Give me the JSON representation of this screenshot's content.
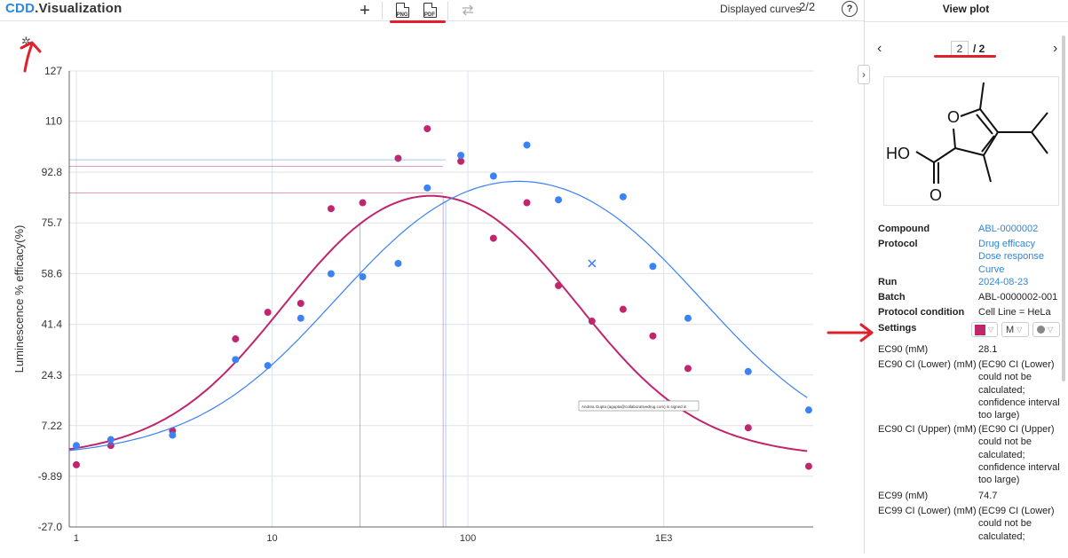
{
  "app": {
    "brand": "CDD",
    "product": "Visualization"
  },
  "toolbar": {
    "add_icon": "plus-icon",
    "png_label": "PNG",
    "pdf_label": "PDF",
    "swap_icon": "swap-icon",
    "displayed_curves_label": "Displayed curves",
    "displayed_curves_value": "2/2",
    "help_label": "?"
  },
  "panel": {
    "title": "View plot",
    "page_current": "2",
    "page_total": "/ 2",
    "properties": [
      {
        "label": "Compound",
        "value": "ABL-0000002",
        "link": true
      },
      {
        "label": "Protocol",
        "value": "Drug efficacy Dose response Curve",
        "link": true
      },
      {
        "label": "Run",
        "value": "2024-08-23",
        "link": true
      },
      {
        "label": "Batch",
        "value": "ABL-0000002-001",
        "link": false
      },
      {
        "label": "Protocol condition",
        "value": "Cell Line = HeLa",
        "link": false
      }
    ],
    "settings_label": "Settings",
    "settings": {
      "color": "#c0256e",
      "method": "M",
      "marker": "circle"
    },
    "results": [
      {
        "label": "EC90 (mM)",
        "value": "28.1"
      },
      {
        "label": "EC90 CI (Lower) (mM)",
        "value": "(EC90 CI (Lower) could not be calculated; confidence interval too large)"
      },
      {
        "label": "EC90 CI (Upper) (mM)",
        "value": "(EC90 CI (Upper) could not be calculated; confidence interval too large)"
      },
      {
        "label": "EC99 (mM)",
        "value": "74.7"
      },
      {
        "label": "EC99 CI (Lower) (mM)",
        "value": "(EC99 CI (Lower) could not be calculated;"
      }
    ]
  },
  "structure": {
    "atom_o_ring": "O",
    "atom_oh": "HO",
    "atom_o_carbonyl": "O"
  },
  "tooltip_text": "Andrea Gupta (agupta@collaborativedrug.com) is signed in",
  "chart_data": {
    "type": "scatter",
    "xscale": "log",
    "xlim": [
      0.92,
      5800
    ],
    "ylim": [
      -27.0,
      127
    ],
    "ylabel": "Luminescence % efficacy(%)",
    "xticks": [
      1,
      10,
      100,
      1000
    ],
    "xtick_labels": [
      "1",
      "10",
      "100",
      "1E3"
    ],
    "yticks": [
      -27.0,
      -9.89,
      7.22,
      24.3,
      41.4,
      58.6,
      75.7,
      92.8,
      110,
      127
    ],
    "ytick_labels": [
      "-27.0",
      "-9.89",
      "7.22",
      "24.3",
      "41.4",
      "58.6",
      "75.7",
      "92.8",
      "110",
      "127"
    ],
    "grid": true,
    "series": [
      {
        "color": "#c0256e",
        "points": [
          [
            1.0,
            -6.0
          ],
          [
            1.5,
            0.5
          ],
          [
            3.1,
            5.5
          ],
          [
            6.5,
            36.5
          ],
          [
            9.5,
            45.5
          ],
          [
            14,
            48.5
          ],
          [
            20,
            80.5
          ],
          [
            29,
            82.5
          ],
          [
            44,
            97.5
          ],
          [
            62,
            107.5
          ],
          [
            92,
            96.5
          ],
          [
            135,
            70.5
          ],
          [
            200,
            82.5
          ],
          [
            290,
            54.5
          ],
          [
            430,
            42.5
          ],
          [
            620,
            46.5
          ],
          [
            880,
            37.5
          ],
          [
            1330,
            26.5
          ],
          [
            2700,
            6.5
          ],
          [
            5500,
            -6.5
          ]
        ],
        "fit": {
          "top": 104,
          "bottom": -4,
          "ec50_rise": 12,
          "ec50_fall": 350,
          "hill": 1.35
        },
        "markers_x": [
          28.1,
          74.7
        ],
        "guides_y": [
          94.8,
          85.8
        ]
      },
      {
        "color": "#3b82f6",
        "points": [
          [
            1.0,
            0.5
          ],
          [
            1.5,
            2.5
          ],
          [
            3.1,
            4.0
          ],
          [
            6.5,
            29.5
          ],
          [
            9.5,
            27.5
          ],
          [
            14,
            43.5
          ],
          [
            20,
            58.5
          ],
          [
            29,
            57.5
          ],
          [
            44,
            62.0
          ],
          [
            62,
            87.5
          ],
          [
            92,
            98.5
          ],
          [
            135,
            91.5
          ],
          [
            200,
            102.0
          ],
          [
            290,
            83.5
          ],
          [
            620,
            84.5
          ],
          [
            880,
            61.0
          ],
          [
            1330,
            43.5
          ],
          [
            2700,
            25.5
          ],
          [
            5500,
            12.5
          ]
        ],
        "excluded": [
          [
            430,
            62.0
          ]
        ],
        "fit": {
          "top": 107,
          "bottom": -4,
          "ec50_rise": 22,
          "ec50_fall": 1500,
          "hill": 1.15
        },
        "markers_x": [
          77
        ],
        "guides_y": [
          97.0
        ]
      }
    ]
  }
}
